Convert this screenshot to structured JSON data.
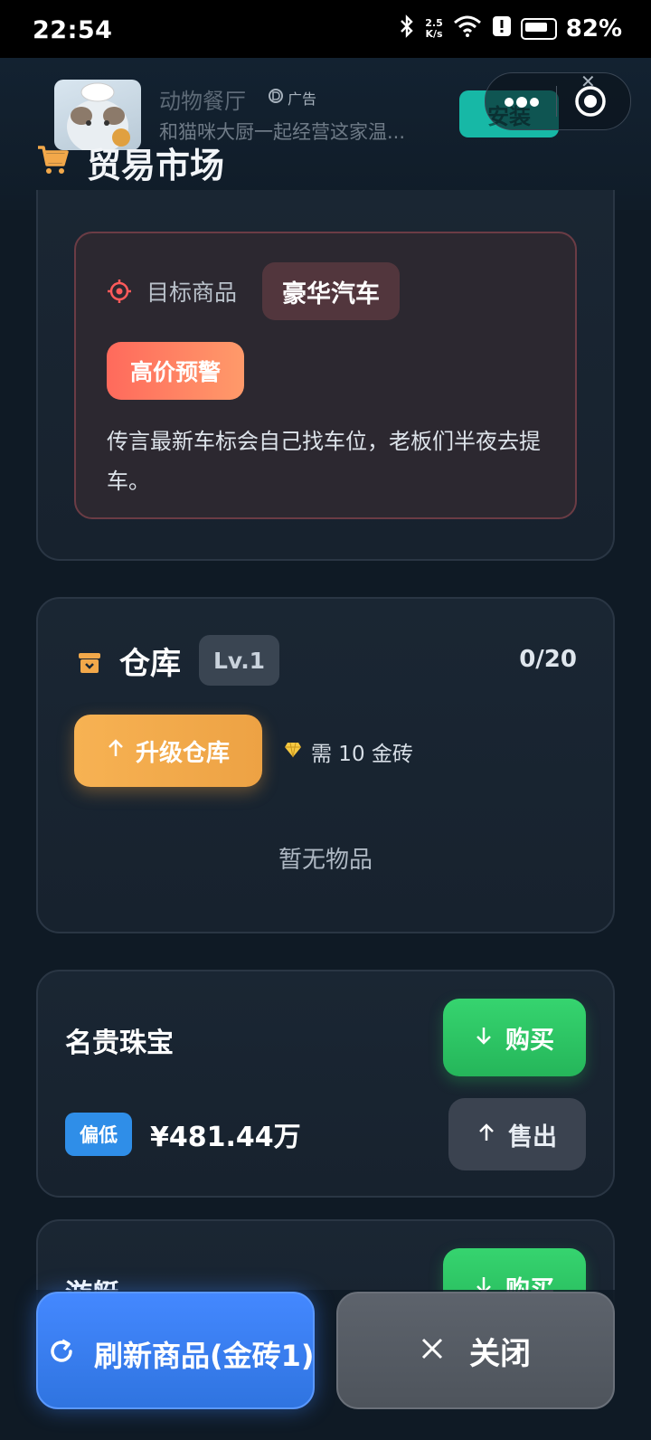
{
  "status_bar": {
    "time": "22:54",
    "net_speed_top": "2.5",
    "net_speed_bottom": "K/s",
    "battery": "82%"
  },
  "ad": {
    "title": "动物餐厅",
    "tag": "广告",
    "description": "和猫咪大厨一起经营这家温...",
    "install_label": "安装"
  },
  "page": {
    "title": "贸易市场"
  },
  "target_alert": {
    "label": "目标商品",
    "product": "豪华汽车",
    "badge": "高价预警",
    "text": "传言最新车标会自己找车位，老板们半夜去提车。"
  },
  "warehouse": {
    "title": "仓库",
    "level": "Lv.1",
    "count": "0/20",
    "upgrade_label": "升级仓库",
    "cost_text": "需 10 金砖",
    "empty_text": "暂无物品"
  },
  "items": [
    {
      "name": "名贵珠宝",
      "buy_label": "购买",
      "trend": "偏低",
      "price": "¥481.44万",
      "sell_label": "售出"
    },
    {
      "name": "游艇",
      "buy_label": "购买"
    }
  ],
  "footer": {
    "refresh_label": "刷新商品(金砖1)",
    "close_label": "关闭"
  },
  "colors": {
    "accent_blue": "#3a7ef0",
    "buy_green": "#2ec465",
    "warn_red": "#ff6a5c",
    "upgrade_orange": "#f2a84a"
  }
}
